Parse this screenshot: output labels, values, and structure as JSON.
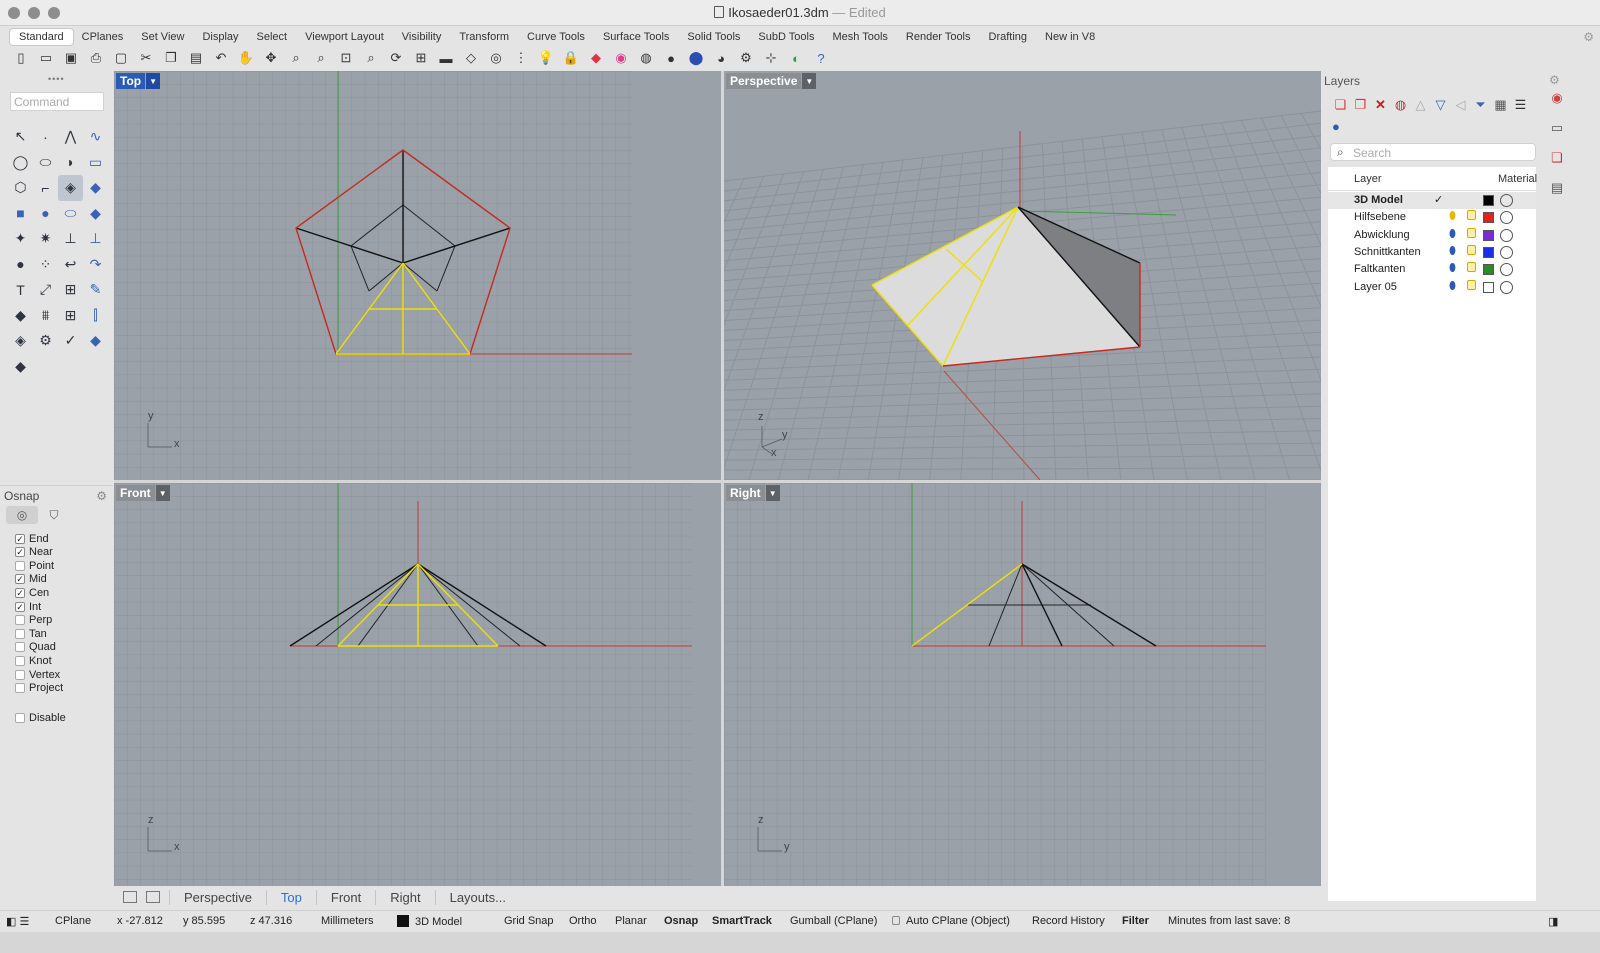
{
  "window": {
    "title": "Ikosaeder01.3dm",
    "edited": "— Edited"
  },
  "tabs": [
    "Standard",
    "CPlanes",
    "Set View",
    "Display",
    "Select",
    "Viewport Layout",
    "Visibility",
    "Transform",
    "Curve Tools",
    "Surface Tools",
    "Solid Tools",
    "SubD Tools",
    "Mesh Tools",
    "Render Tools",
    "Drafting",
    "New in V8"
  ],
  "toolbar_icons": [
    "new-file-icon",
    "open-folder-icon",
    "save-icon",
    "print-icon",
    "import-icon",
    "cut-icon",
    "copy-icon",
    "paste-icon",
    "undo-icon",
    "pan-hand-icon",
    "rotate-view-icon",
    "zoom-window-icon",
    "zoom-extents-icon",
    "zoom-selected-icon",
    "zoom-dynamic-icon",
    "rotate-icon",
    "four-viewports-icon",
    "car-icon",
    "cplane-icon",
    "osnap-circle-icon",
    "snap-grid-icon",
    "light-bulb-icon",
    "lock-icon",
    "layer-icon",
    "color-wheel-icon",
    "wireframe-sphere-icon",
    "shaded-sphere-icon",
    "rendered-sphere-icon",
    "render-icon",
    "gear-icon",
    "options-icon",
    "globe-icon",
    "help-icon"
  ],
  "command": {
    "placeholder": "Command"
  },
  "viewports": {
    "top": "Top",
    "perspective": "Perspective",
    "front": "Front",
    "right": "Right"
  },
  "axes": {
    "x": "x",
    "y": "y",
    "z": "z"
  },
  "osnap": {
    "title": "Osnap",
    "items": [
      {
        "label": "End",
        "checked": true
      },
      {
        "label": "Near",
        "checked": true
      },
      {
        "label": "Point",
        "checked": false
      },
      {
        "label": "Mid",
        "checked": true
      },
      {
        "label": "Cen",
        "checked": true
      },
      {
        "label": "Int",
        "checked": true
      },
      {
        "label": "Perp",
        "checked": false
      },
      {
        "label": "Tan",
        "checked": false
      },
      {
        "label": "Quad",
        "checked": false
      },
      {
        "label": "Knot",
        "checked": false
      },
      {
        "label": "Vertex",
        "checked": false
      },
      {
        "label": "Project",
        "checked": false
      }
    ],
    "disable": "Disable"
  },
  "viewport_tabs": [
    "Perspective",
    "Top",
    "Front",
    "Right",
    "Layouts..."
  ],
  "active_viewport_tab": "Top",
  "layers": {
    "title": "Layers",
    "search_placeholder": "Search",
    "col_layer": "Layer",
    "col_material": "Material",
    "rows": [
      {
        "name": "3D Model",
        "current": true,
        "color": "#000000",
        "bulb": "blue"
      },
      {
        "name": "Hilfsebene",
        "current": false,
        "color": "#e2231a",
        "bulb": "yellow"
      },
      {
        "name": "Abwicklung",
        "current": false,
        "color": "#7a2bd6",
        "bulb": "blue"
      },
      {
        "name": "Schnittkanten",
        "current": false,
        "color": "#1a2ee6",
        "bulb": "blue"
      },
      {
        "name": "Faltkanten",
        "current": false,
        "color": "#2a8a2a",
        "bulb": "blue"
      },
      {
        "name": "Layer 05",
        "current": false,
        "color": "#ffffff",
        "bulb": "blue"
      }
    ]
  },
  "status": {
    "cplane": "CPlane",
    "x": "x -27.812",
    "y": "y 85.595",
    "z": "z 47.316",
    "units": "Millimeters",
    "layer": "3D Model",
    "grid_snap": "Grid Snap",
    "ortho": "Ortho",
    "planar": "Planar",
    "osnap": "Osnap",
    "smarttrack": "SmartTrack",
    "gumball": "Gumball (CPlane)",
    "auto_cplane": "Auto CPlane (Object)",
    "record_history": "Record History",
    "filter": "Filter",
    "minutes": "Minutes from last save: 8"
  },
  "colors": {
    "grid_bg": "#9aa1a9",
    "active_tab": "#2a5bb6",
    "red": "#d12a1e",
    "yellow": "#f0e000",
    "green": "#3da03d"
  }
}
